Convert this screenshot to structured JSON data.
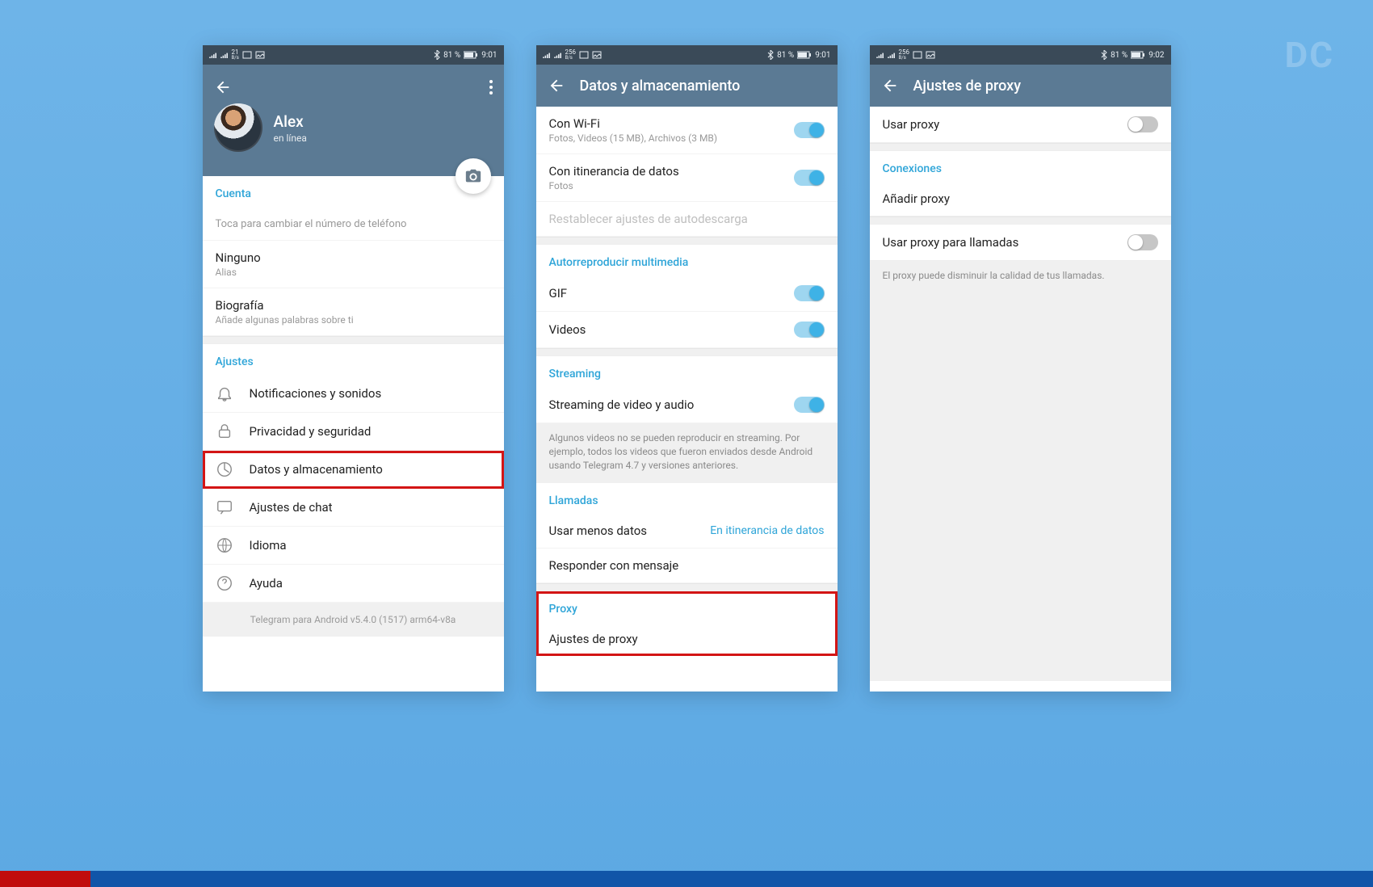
{
  "watermark": "DC",
  "status": {
    "speed1": "21",
    "speed_unit": "B/s",
    "speed2": "256",
    "bt_batt": "81 %",
    "battery_icon": "battery",
    "time1": "9:01",
    "time2": "9:01",
    "time3": "9:02"
  },
  "phone1": {
    "name": "Alex",
    "status": "en línea",
    "account_header": "Cuenta",
    "phone_hint": "Toca para cambiar el número de teléfono",
    "alias_title": "Ninguno",
    "alias_sub": "Alias",
    "bio_title": "Biografía",
    "bio_sub": "Añade algunas palabras sobre ti",
    "settings_header": "Ajustes",
    "items": {
      "notifications": "Notificaciones y sonidos",
      "privacy": "Privacidad y seguridad",
      "data": "Datos y almacenamiento",
      "chat": "Ajustes de chat",
      "language": "Idioma",
      "help": "Ayuda"
    },
    "footer": "Telegram para Android v5.4.0 (1517) arm64-v8a"
  },
  "phone2": {
    "title": "Datos y almacenamiento",
    "wifi_title": "Con Wi-Fi",
    "wifi_sub": "Fotos, Videos (15 MB), Archivos (3 MB)",
    "roaming_title": "Con itinerancia de datos",
    "roaming_sub": "Fotos",
    "reset": "Restablecer ajustes de autodescarga",
    "autoplay_header": "Autorreproducir multimedia",
    "gif": "GIF",
    "videos": "Videos",
    "streaming_header": "Streaming",
    "streaming_title": "Streaming de video y audio",
    "streaming_hint": "Algunos videos no se pueden reproducir en streaming. Por ejemplo, todos los videos que fueron enviados desde Android usando Telegram 4.7 y versiones anteriores.",
    "calls_header": "Llamadas",
    "less_data": "Usar menos datos",
    "less_data_value": "En itinerancia de datos",
    "reply_msg": "Responder con mensaje",
    "proxy_header": "Proxy",
    "proxy_settings": "Ajustes de proxy"
  },
  "phone3": {
    "title": "Ajustes de proxy",
    "use_proxy": "Usar proxy",
    "connections_header": "Conexiones",
    "add_proxy": "Añadir proxy",
    "use_proxy_calls": "Usar proxy para llamadas",
    "hint": "El proxy puede disminuir la calidad de tus llamadas."
  }
}
